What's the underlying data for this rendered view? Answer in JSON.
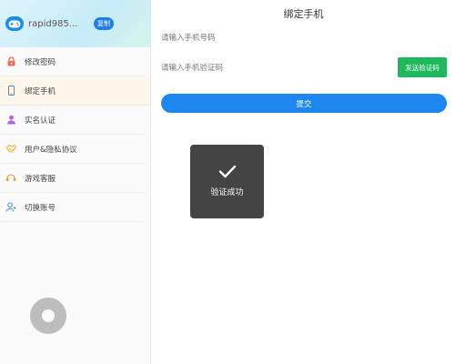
{
  "sidebar": {
    "username": "rapid985...",
    "copy_label": "复制",
    "items": [
      {
        "label": "修改密码",
        "icon": "lock-icon",
        "color": "#f06b5a"
      },
      {
        "label": "绑定手机",
        "icon": "phone-icon",
        "color": "#3a8ee6",
        "active": true
      },
      {
        "label": "实名认证",
        "icon": "user-id-icon",
        "color": "#b066e0"
      },
      {
        "label": "用户&隐私协议",
        "icon": "handshake-icon",
        "color": "#f2b531"
      },
      {
        "label": "游戏客服",
        "icon": "customer-service-icon",
        "color": "#f29a2e"
      },
      {
        "label": "切换账号",
        "icon": "switch-account-icon",
        "color": "#3a8ee6"
      }
    ]
  },
  "main": {
    "title": "绑定手机",
    "phone_placeholder": "请输入手机号码",
    "code_placeholder": "请输入手机验证码",
    "send_code_label": "发送验证码",
    "submit_label": "提交"
  },
  "toast": {
    "text": "验证成功"
  },
  "colors": {
    "accent": "#1e86ef",
    "send_code": "#1fb85d",
    "toast_bg": "#3a3a3a"
  }
}
